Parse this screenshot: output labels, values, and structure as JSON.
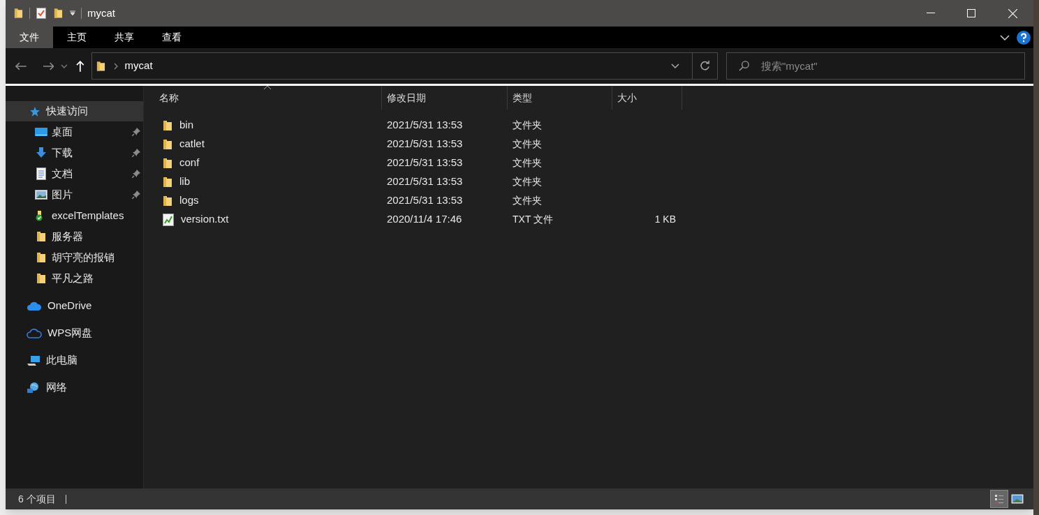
{
  "window": {
    "title": "mycat"
  },
  "ribbon_tabs": [
    {
      "label": "文件",
      "selected": true
    },
    {
      "label": "主页",
      "selected": false
    },
    {
      "label": "共享",
      "selected": false
    },
    {
      "label": "查看",
      "selected": false
    }
  ],
  "address": {
    "path": "mycat"
  },
  "search": {
    "placeholder": "搜索\"mycat\""
  },
  "sidebar": {
    "items": [
      {
        "label": "快速访问",
        "kind": "star",
        "selected": true,
        "children": [
          {
            "label": "桌面",
            "kind": "desktop",
            "pinned": true
          },
          {
            "label": "下载",
            "kind": "download",
            "pinned": true
          },
          {
            "label": "文档",
            "kind": "document",
            "pinned": true
          },
          {
            "label": "图片",
            "kind": "pictures",
            "pinned": true
          },
          {
            "label": "excelTemplates",
            "kind": "synced-folder",
            "pinned": false
          },
          {
            "label": "服务器",
            "kind": "folder",
            "pinned": false
          },
          {
            "label": "胡守亮的报销",
            "kind": "folder",
            "pinned": false
          },
          {
            "label": "平凡之路",
            "kind": "folder",
            "pinned": false
          }
        ]
      },
      {
        "label": "OneDrive",
        "kind": "cloud",
        "selected": false
      },
      {
        "label": "WPS网盘",
        "kind": "cloud-outline",
        "selected": false
      },
      {
        "label": "此电脑",
        "kind": "computer",
        "selected": false
      },
      {
        "label": "网络",
        "kind": "network",
        "selected": false
      }
    ]
  },
  "table": {
    "columns": [
      {
        "label": "名称",
        "sorted": true
      },
      {
        "label": "修改日期",
        "sorted": false
      },
      {
        "label": "类型",
        "sorted": false
      },
      {
        "label": "大小",
        "sorted": false
      }
    ],
    "rows": [
      {
        "name": "bin",
        "kind": "folder",
        "date": "2021/5/31 13:53",
        "type": "文件夹"
      },
      {
        "name": "catlet",
        "kind": "folder",
        "date": "2021/5/31 13:53",
        "type": "文件夹"
      },
      {
        "name": "conf",
        "kind": "folder",
        "date": "2021/5/31 13:53",
        "type": "文件夹"
      },
      {
        "name": "lib",
        "kind": "folder",
        "date": "2021/5/31 13:53",
        "type": "文件夹"
      },
      {
        "name": "logs",
        "kind": "folder",
        "date": "2021/5/31 13:53",
        "type": "文件夹"
      },
      {
        "name": "version.txt",
        "kind": "text",
        "date": "2020/11/4 17:46",
        "type": "TXT 文件",
        "size": "1 KB"
      }
    ]
  },
  "status_bar": {
    "text": "6 个项目",
    "views": [
      {
        "kind": "details",
        "selected": true
      },
      {
        "kind": "large-icons",
        "selected": false
      }
    ]
  }
}
